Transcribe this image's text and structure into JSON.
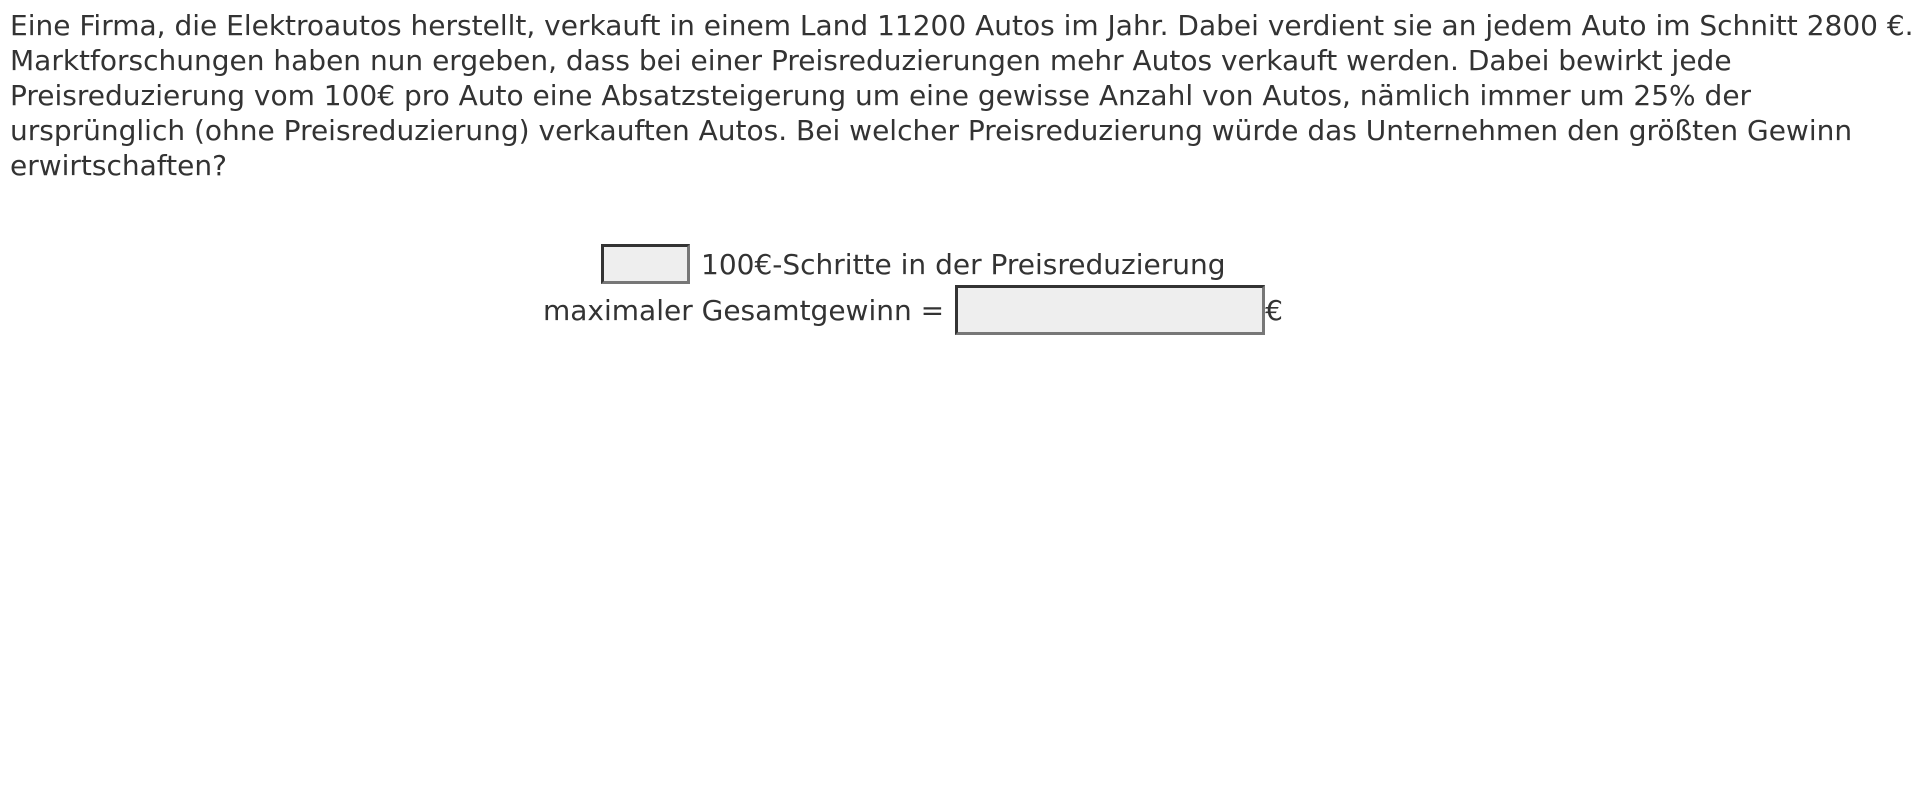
{
  "question": {
    "text": "Eine Firma, die Elektroautos herstellt, verkauft in einem Land 11200 Autos im Jahr. Dabei verdient sie an jedem Auto im Schnitt 2800 €. Marktforschungen haben nun ergeben, dass bei einer Preisreduzierungen mehr Autos verkauft werden. Dabei bewirkt jede Preisreduzierung vom 100€ pro Auto eine Absatzsteigerung um eine gewisse Anzahl von Autos, nämlich immer um 25% der ursprünglich (ohne Preisreduzierung) verkauften Autos. Bei welcher Preisreduzierung würde das Unternehmen den größten Gewinn erwirtschaften?"
  },
  "answers": {
    "steps": {
      "value": "",
      "label": "100€-Schritte in der Preisreduzierung"
    },
    "profit": {
      "label": "maximaler Gesamtgewinn =",
      "value": "",
      "unit": "€"
    }
  }
}
